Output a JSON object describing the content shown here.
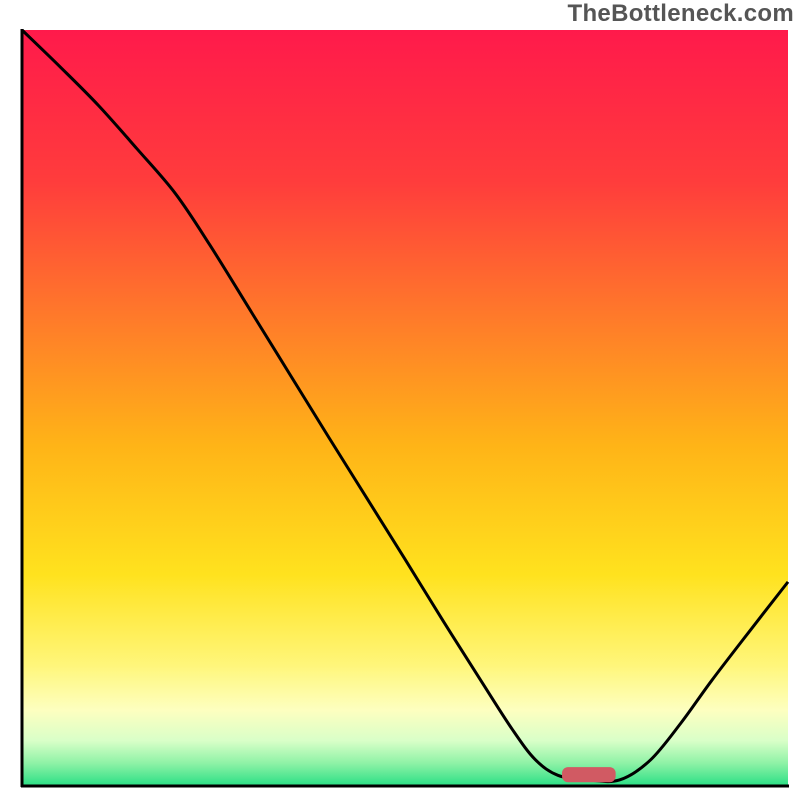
{
  "watermark": "TheBottleneck.com",
  "chart_data": {
    "type": "line",
    "title": "",
    "xlabel": "",
    "ylabel": "",
    "xlim": [
      0,
      100
    ],
    "ylim": [
      0,
      100
    ],
    "background_gradient": {
      "stops": [
        {
          "offset": 0.0,
          "color": "#ff1a4b"
        },
        {
          "offset": 0.2,
          "color": "#ff3c3c"
        },
        {
          "offset": 0.38,
          "color": "#ff7a2a"
        },
        {
          "offset": 0.55,
          "color": "#ffb417"
        },
        {
          "offset": 0.72,
          "color": "#ffe21e"
        },
        {
          "offset": 0.84,
          "color": "#fff67a"
        },
        {
          "offset": 0.9,
          "color": "#fdffc0"
        },
        {
          "offset": 0.94,
          "color": "#d9ffc8"
        },
        {
          "offset": 0.97,
          "color": "#8ef2a6"
        },
        {
          "offset": 1.0,
          "color": "#2adf85"
        }
      ]
    },
    "marker": {
      "x": 74,
      "y": 1.5,
      "width": 7,
      "height": 2,
      "color": "#d15a63"
    },
    "series": [
      {
        "name": "curve",
        "color": "#000000",
        "x": [
          0.0,
          5.0,
          10.0,
          15.0,
          20.0,
          24.5,
          30.0,
          35.0,
          40.0,
          45.0,
          50.0,
          55.0,
          60.0,
          64.0,
          67.0,
          70.0,
          74.0,
          78.0,
          82.0,
          86.0,
          90.0,
          95.0,
          100.0
        ],
        "y": [
          100.0,
          95.1,
          90.0,
          84.3,
          78.4,
          71.6,
          62.6,
          54.4,
          46.2,
          38.1,
          30.0,
          21.8,
          13.8,
          7.5,
          3.5,
          1.4,
          0.8,
          0.8,
          3.4,
          8.3,
          13.9,
          20.5,
          27.0
        ]
      }
    ]
  }
}
